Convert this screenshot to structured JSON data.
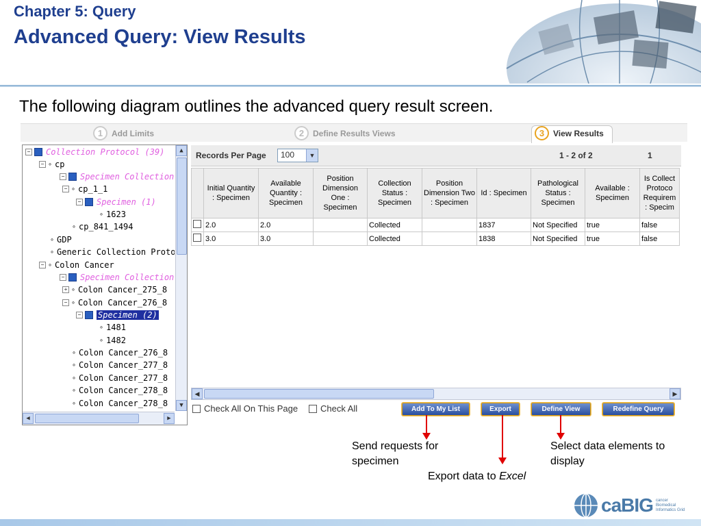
{
  "slide": {
    "title_line1": "Chapter 5: Query",
    "title_line2": "Advanced Query: View Results",
    "subtitle": "The following diagram outlines the advanced query result screen."
  },
  "wizard": {
    "steps": [
      {
        "num": "1",
        "label": "Add Limits"
      },
      {
        "num": "2",
        "label": "Define Results Views"
      },
      {
        "num": "3",
        "label": "View Results"
      }
    ]
  },
  "tree": {
    "nodes": [
      {
        "label": "Collection Protocol (39)"
      },
      {
        "label": "cp"
      },
      {
        "label": "Specimen Collection Grou"
      },
      {
        "label": "cp_1_1"
      },
      {
        "label": "Specimen (1)"
      },
      {
        "label": "1623"
      },
      {
        "label": "cp_841_1494"
      },
      {
        "label": "GDP"
      },
      {
        "label": "Generic Collection Protocol"
      },
      {
        "label": "Colon Cancer"
      },
      {
        "label": "Specimen Collection Grou"
      },
      {
        "label": "Colon Cancer_275_8"
      },
      {
        "label": "Colon Cancer_276_8"
      },
      {
        "label": "Specimen (2)"
      },
      {
        "label": "1481"
      },
      {
        "label": "1482"
      },
      {
        "label": "Colon Cancer_276_8"
      },
      {
        "label": "Colon Cancer_277_8"
      },
      {
        "label": "Colon Cancer_277_8"
      },
      {
        "label": "Colon Cancer_278_8"
      },
      {
        "label": "Colon Cancer_278_8"
      }
    ]
  },
  "results": {
    "records_per_page_label": "Records Per Page",
    "records_per_page_value": "100",
    "paging_text": "1 - 2 of 2",
    "page_number": "1",
    "columns": [
      "Initial Quantity : Specimen",
      "Available Quantity : Specimen",
      "Position Dimension One : Specimen",
      "Collection Status : Specimen",
      "Position Dimension Two : Specimen",
      "Id : Specimen",
      "Pathological Status : Specimen",
      "Available : Specimen",
      "Is Collect Protoco Requirem : Specim"
    ],
    "rows": [
      [
        "2.0",
        "2.0",
        "",
        "Collected",
        "",
        "1837",
        "Not Specified",
        "true",
        "false"
      ],
      [
        "3.0",
        "3.0",
        "",
        "Collected",
        "",
        "1838",
        "Not Specified",
        "true",
        "false"
      ]
    ],
    "check_all_page_label": "Check All On This Page",
    "check_all_label": "Check All",
    "buttons": {
      "add_to_list": "Add To My List",
      "export": "Export",
      "define_view": "Define View",
      "redefine_query": "Redefine Query"
    }
  },
  "callouts": {
    "send_requests": "Send requests for specimen",
    "export_prefix": "Export data to",
    "export_app": "Excel",
    "select_elements": "Select data elements to display"
  },
  "logo": {
    "word": "caBIG",
    "tagline": "cancer Biomedical Informatics Grid"
  },
  "colors": {
    "title": "#1f3f8f",
    "arrow": "#e00000",
    "button": "#2a4f9f",
    "tree_pink": "#e060e0",
    "selected": "#1f2fa0"
  }
}
